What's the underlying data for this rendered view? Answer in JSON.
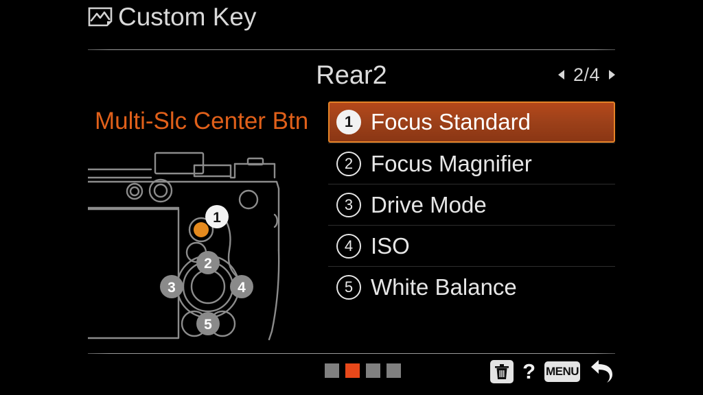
{
  "header": {
    "icon": "photo-frame-icon",
    "title": "Custom Key"
  },
  "page": {
    "title": "Rear2",
    "indicator": "2/4",
    "prev_arrow": "left-triangle-icon",
    "next_arrow": "right-triangle-icon",
    "current_page": 2,
    "total_pages": 4
  },
  "assignment": {
    "label": "Multi-Slc Center Btn"
  },
  "camera_diagram": {
    "name": "camera-rear-illustration",
    "markers": [
      {
        "number": "1",
        "state": "active"
      },
      {
        "number": "2",
        "state": "inactive"
      },
      {
        "number": "3",
        "state": "inactive"
      },
      {
        "number": "4",
        "state": "inactive"
      },
      {
        "number": "5",
        "state": "inactive"
      }
    ]
  },
  "options": [
    {
      "number": "1",
      "label": "Focus Standard",
      "selected": true
    },
    {
      "number": "2",
      "label": "Focus Magnifier",
      "selected": false
    },
    {
      "number": "3",
      "label": "Drive Mode",
      "selected": false
    },
    {
      "number": "4",
      "label": "ISO",
      "selected": false
    },
    {
      "number": "5",
      "label": "White Balance",
      "selected": false
    }
  ],
  "bottom_bar": {
    "dots": [
      "inactive",
      "active",
      "inactive",
      "inactive"
    ],
    "delete_icon": "trash-icon",
    "help_label": "?",
    "menu_label": "MENU",
    "back_icon": "back-arrow-icon"
  },
  "colors": {
    "accent_orange": "#e0601a",
    "selected_border": "#e58327",
    "dot_active": "#e8481a",
    "text": "#e6e6e6",
    "background": "#000000",
    "diagram_line": "#8c8c8c"
  }
}
